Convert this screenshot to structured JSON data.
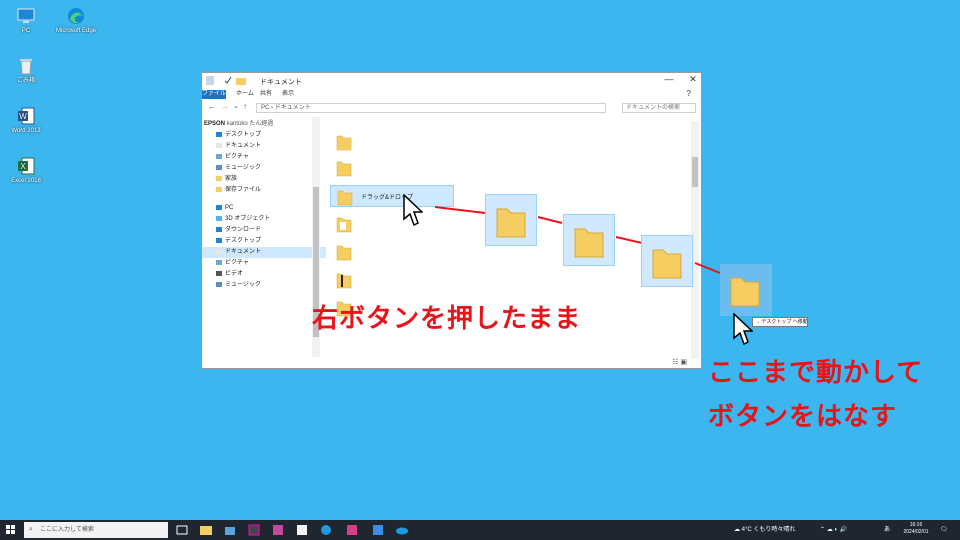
{
  "desktop": {
    "icons": [
      {
        "label": "PC"
      },
      {
        "label": "Microsoft Edge"
      },
      {
        "label": "ごみ箱"
      },
      {
        "label": "Word 2013"
      },
      {
        "label": "Excel 2016"
      }
    ]
  },
  "explorer": {
    "title": "ドキュメント",
    "tabs": [
      "ファイル",
      "ホーム",
      "共有",
      "表示"
    ],
    "address": [
      "PC",
      "ドキュメント"
    ],
    "search_placeholder": "ドキュメントの検索",
    "nav_header": "EPSON",
    "nav_user": "kantoko",
    "nav_user2": "たん経過",
    "nav_items": [
      "デスクトップ",
      "ドキュメント",
      "ピクチャ",
      "ミュージック",
      "家族",
      "保存ファイル"
    ],
    "pc_label": "PC",
    "pc_items": [
      "3D オブジェクト",
      "ダウンロード",
      "デスクトップ",
      "ドキュメント",
      "ピクチャ",
      "ビデオ",
      "ミュージック"
    ],
    "selected_folder": "ドラッグ&ドロップ"
  },
  "annotations": {
    "step1": "右ボタンを押したまま",
    "step2": "ここまで動かして",
    "step3": "ボタンをはなす"
  },
  "drag_tooltip": "→ デスクトップ へ移動",
  "taskbar": {
    "search_placeholder": "ここに入力して検索",
    "weather": "4°C くもり時々晴れ",
    "time": "16:16",
    "date": "2024/02/01",
    "ime": "あ"
  },
  "colors": {
    "desktop": "#3cb6ef",
    "annotation": "#e8141a",
    "selection": "#cde8ff",
    "folder": "#f5cd61"
  }
}
